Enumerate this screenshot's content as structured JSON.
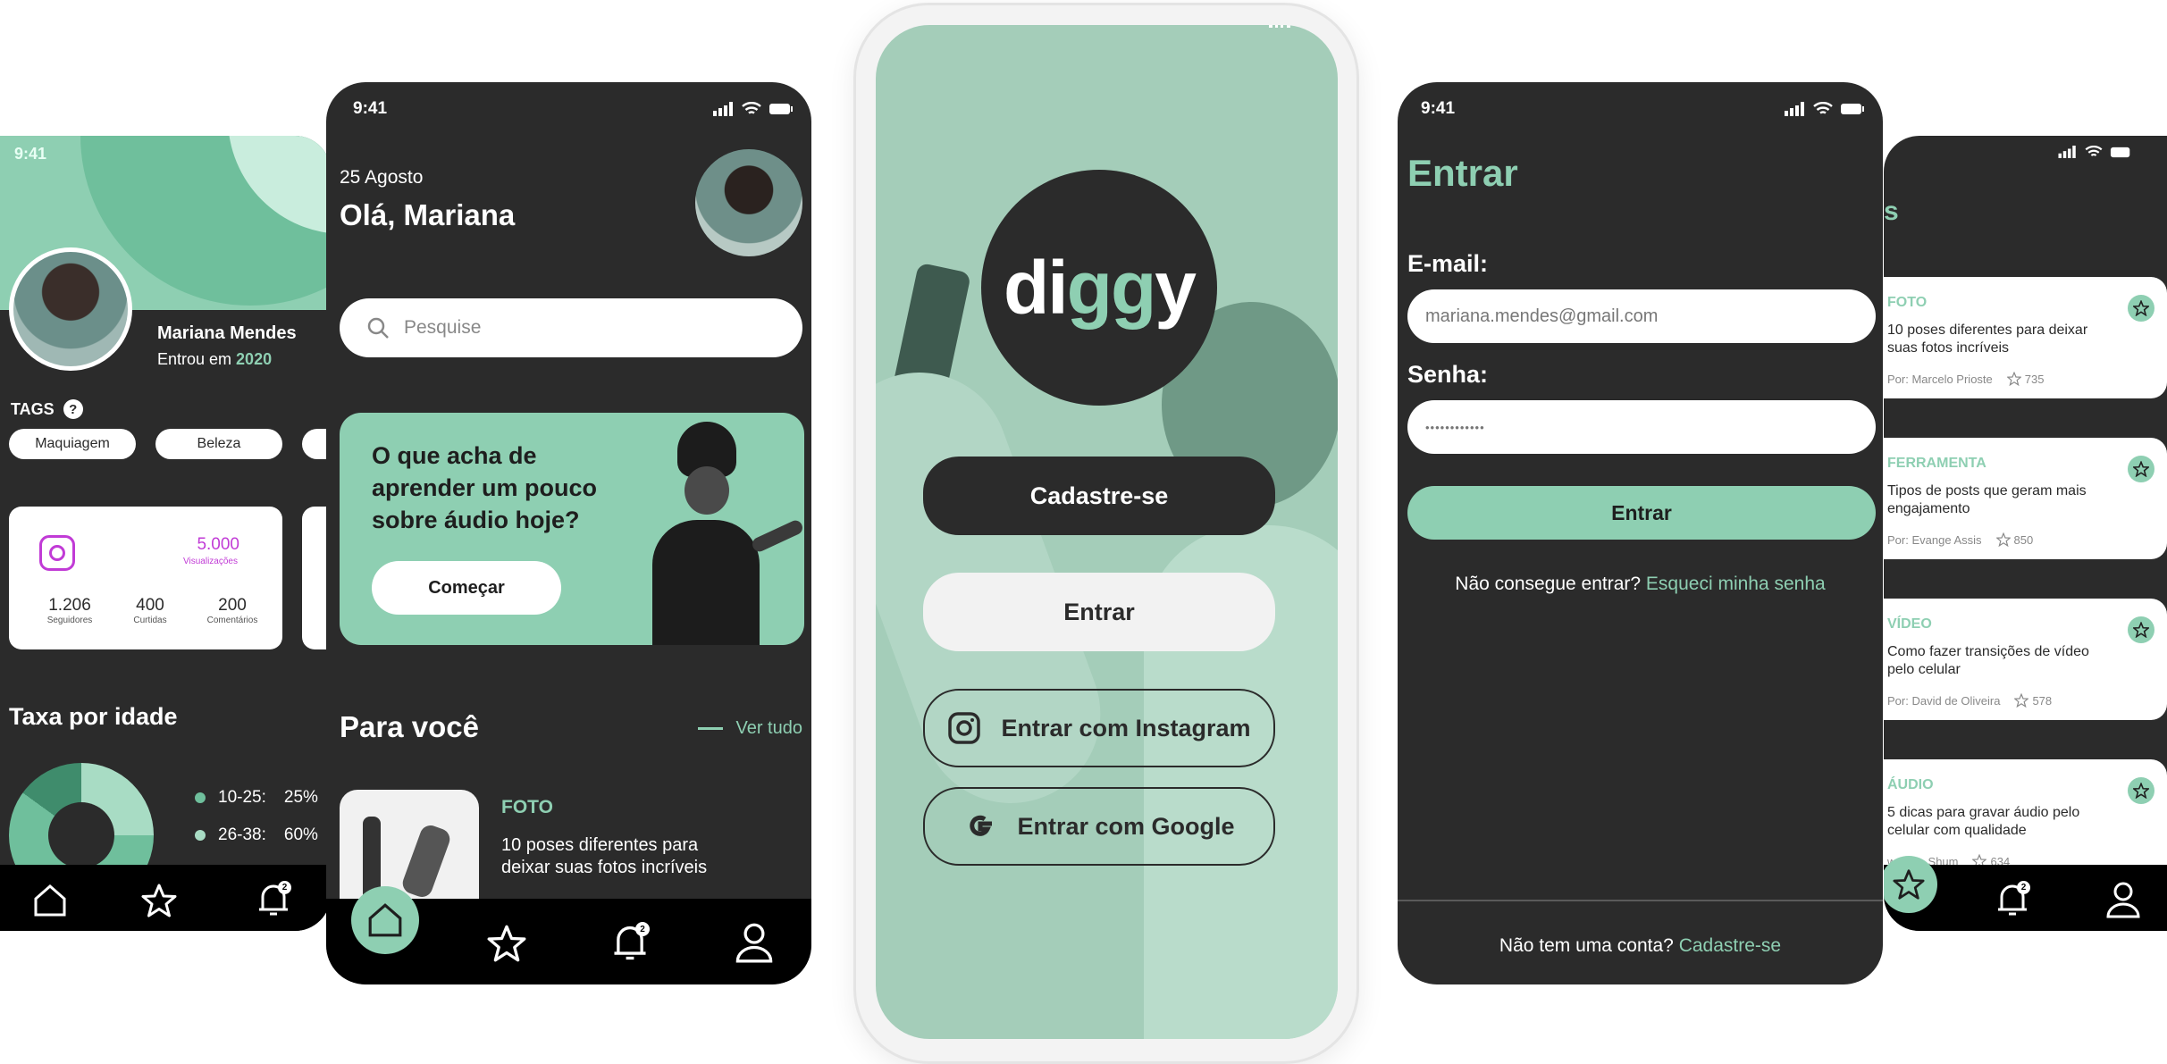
{
  "status": {
    "time": "9:41"
  },
  "profile": {
    "name": "Mariana Mendes",
    "joined_prefix": "Entrou em ",
    "joined_year": "2020",
    "tags_label": "TAGS",
    "tags": [
      "Maquiagem",
      "Beleza"
    ],
    "views_value": "5.000",
    "views_label": "Visualizações",
    "stats": [
      {
        "value": "1.206",
        "label": "Seguidores"
      },
      {
        "value": "400",
        "label": "Curtidas"
      },
      {
        "value": "200",
        "label": "Comentários"
      }
    ],
    "age_title": "Taxa por idade",
    "age_legend": [
      {
        "range": "10-25:",
        "pct": "25%"
      },
      {
        "range": "26-38:",
        "pct": "60%"
      }
    ],
    "notif_count": "2"
  },
  "home": {
    "date": "25 Agosto",
    "greeting": "Olá, Mariana",
    "search_placeholder": "Pesquise",
    "promo_text": "O que acha de aprender um pouco sobre áudio hoje?",
    "promo_button": "Começar",
    "section_title": "Para você",
    "see_all": "Ver tudo",
    "item_category": "FOTO",
    "item_title": "10 poses diferentes para deixar suas fotos incríveis",
    "notif_count": "2"
  },
  "splash": {
    "logo_left": "di",
    "logo_mid": "gg",
    "logo_right": "y",
    "signup": "Cadastre-se",
    "login": "Entrar",
    "instagram": "Entrar com Instagram",
    "google": "Entrar com Google"
  },
  "login": {
    "title": "Entrar",
    "email_label": "E-mail:",
    "email_value": "mariana.mendes@gmail.com",
    "password_label": "Senha:",
    "password_value": "••••••••••••",
    "button": "Entrar",
    "forgot_prefix": "Não consegue entrar? ",
    "forgot_link": "Esqueci minha senha",
    "signup_prefix": "Não tem uma conta? ",
    "signup_link": "Cadastre-se"
  },
  "list": {
    "heading_fragment": "s",
    "items": [
      {
        "category": "FOTO",
        "title": "10 poses diferentes para deixar suas fotos incríveis",
        "author": "Por: Marcelo Prioste",
        "stars": "735"
      },
      {
        "category": "FERRAMENTA",
        "title": "Tipos de posts que geram mais engajamento",
        "author": "Por: Evange Assis",
        "stars": "850"
      },
      {
        "category": "VÍDEO",
        "title": "Como fazer transições de vídeo pelo celular",
        "author": "Por: David de Oliveira",
        "stars": "578"
      },
      {
        "category": "ÁUDIO",
        "title": "5 dicas para gravar áudio pelo celular com qualidade",
        "author": "wrence Shum",
        "stars": "634"
      }
    ],
    "notif_count": "2"
  },
  "colors": {
    "mint": "#8ecfb2",
    "dark": "#2b2b2b",
    "accent_pink": "#c13bd6"
  }
}
